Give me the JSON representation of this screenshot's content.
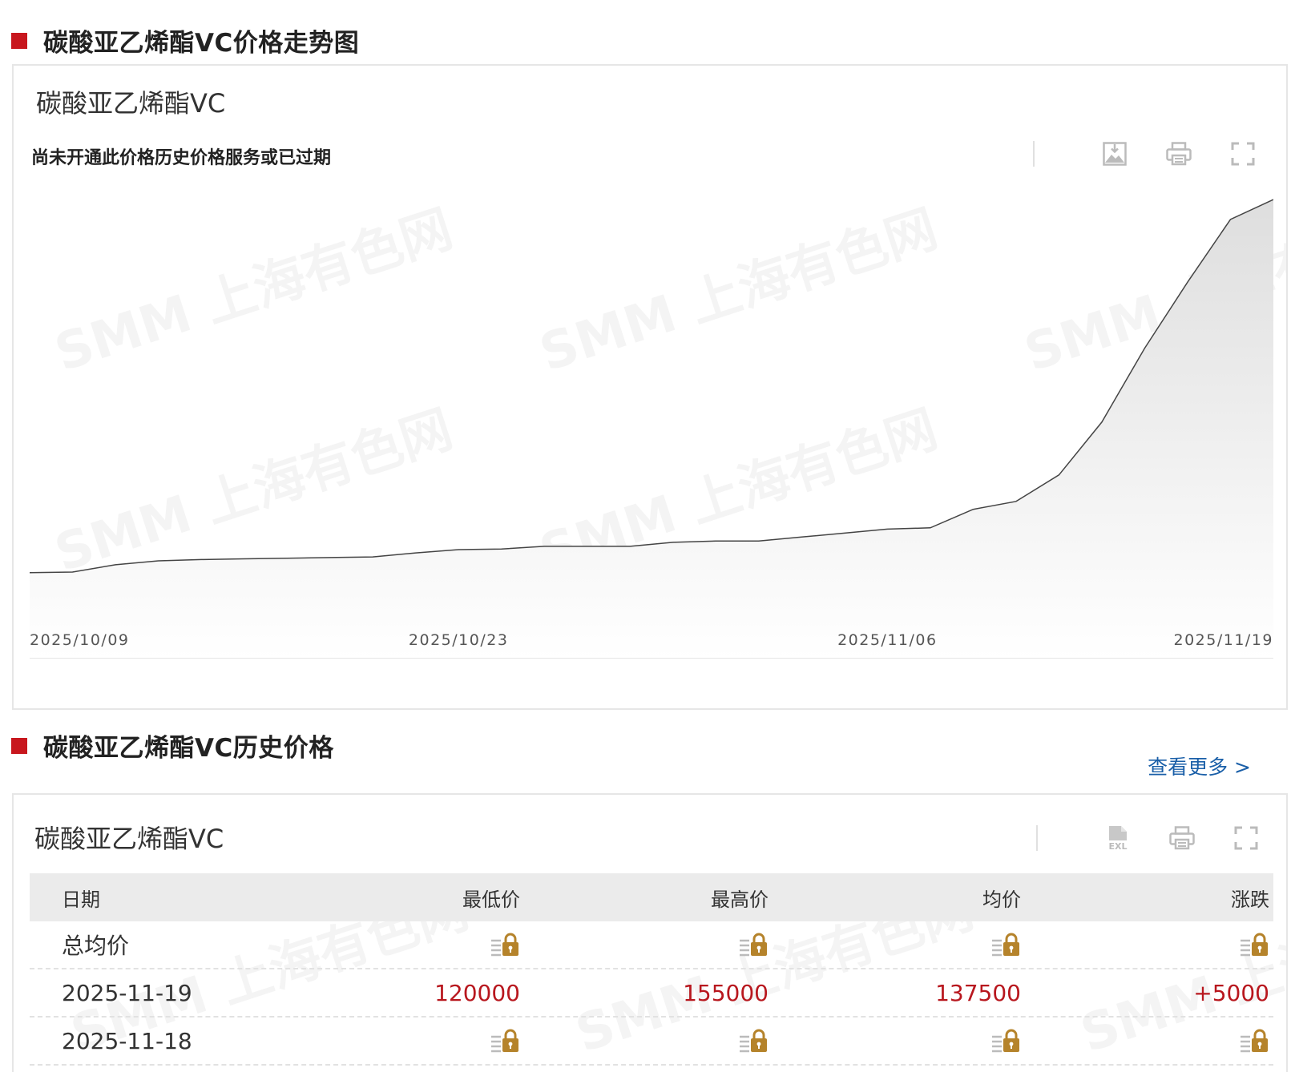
{
  "chart_section": {
    "title": "碳酸亚乙烯酯VC价格走势图",
    "panel_title": "碳酸亚乙烯酯VC",
    "notice": "尚未开通此价格历史价格服务或已过期",
    "tools": [
      "download-image-icon",
      "print-icon",
      "fullscreen-icon"
    ]
  },
  "watermark": {
    "brand": "SMM",
    "cn": "上海有色网"
  },
  "chart_data": {
    "type": "area",
    "x_ticks": [
      "2025/10/09",
      "2025/10/23",
      "2025/11/06",
      "2025/11/19"
    ],
    "x": [
      "2025/10/09",
      "2025/10/10",
      "2025/10/13",
      "2025/10/14",
      "2025/10/15",
      "2025/10/16",
      "2025/10/17",
      "2025/10/20",
      "2025/10/21",
      "2025/10/22",
      "2025/10/23",
      "2025/10/24",
      "2025/10/27",
      "2025/10/28",
      "2025/10/29",
      "2025/10/30",
      "2025/10/31",
      "2025/11/03",
      "2025/11/04",
      "2025/11/05",
      "2025/11/06",
      "2025/11/07",
      "2025/11/10",
      "2025/11/11",
      "2025/11/12",
      "2025/11/13",
      "2025/11/14",
      "2025/11/17",
      "2025/11/18",
      "2025/11/19"
    ],
    "values": [
      46000,
      46100,
      47200,
      47800,
      48000,
      48100,
      48200,
      48300,
      48400,
      49000,
      49500,
      49600,
      50000,
      50000,
      50000,
      50600,
      50800,
      50800,
      51400,
      52000,
      52600,
      52800,
      55600,
      56800,
      60800,
      68800,
      80000,
      90000,
      99500,
      102500
    ],
    "ylim": [
      33000,
      107000
    ],
    "grid": false,
    "line_color": "#444444"
  },
  "history_section": {
    "title": "碳酸亚乙烯酯VC历史价格",
    "more_link": "查看更多 >",
    "panel_title": "碳酸亚乙烯酯VC",
    "tools": [
      "excel-export-icon",
      "print-icon",
      "fullscreen-icon"
    ],
    "columns": [
      "日期",
      "最低价",
      "最高价",
      "均价",
      "涨跌"
    ],
    "rows": [
      {
        "date": "总均价",
        "locked": true
      },
      {
        "date": "2025-11-19",
        "locked": false,
        "low": "120000",
        "high": "155000",
        "avg": "137500",
        "change": "+5000"
      },
      {
        "date": "2025-11-18",
        "locked": true
      }
    ]
  },
  "colors": {
    "accent_red": "#c8171e",
    "price_red": "#b8171e",
    "link_blue": "#1a5fa8",
    "lock_gold": "#b5832b"
  }
}
